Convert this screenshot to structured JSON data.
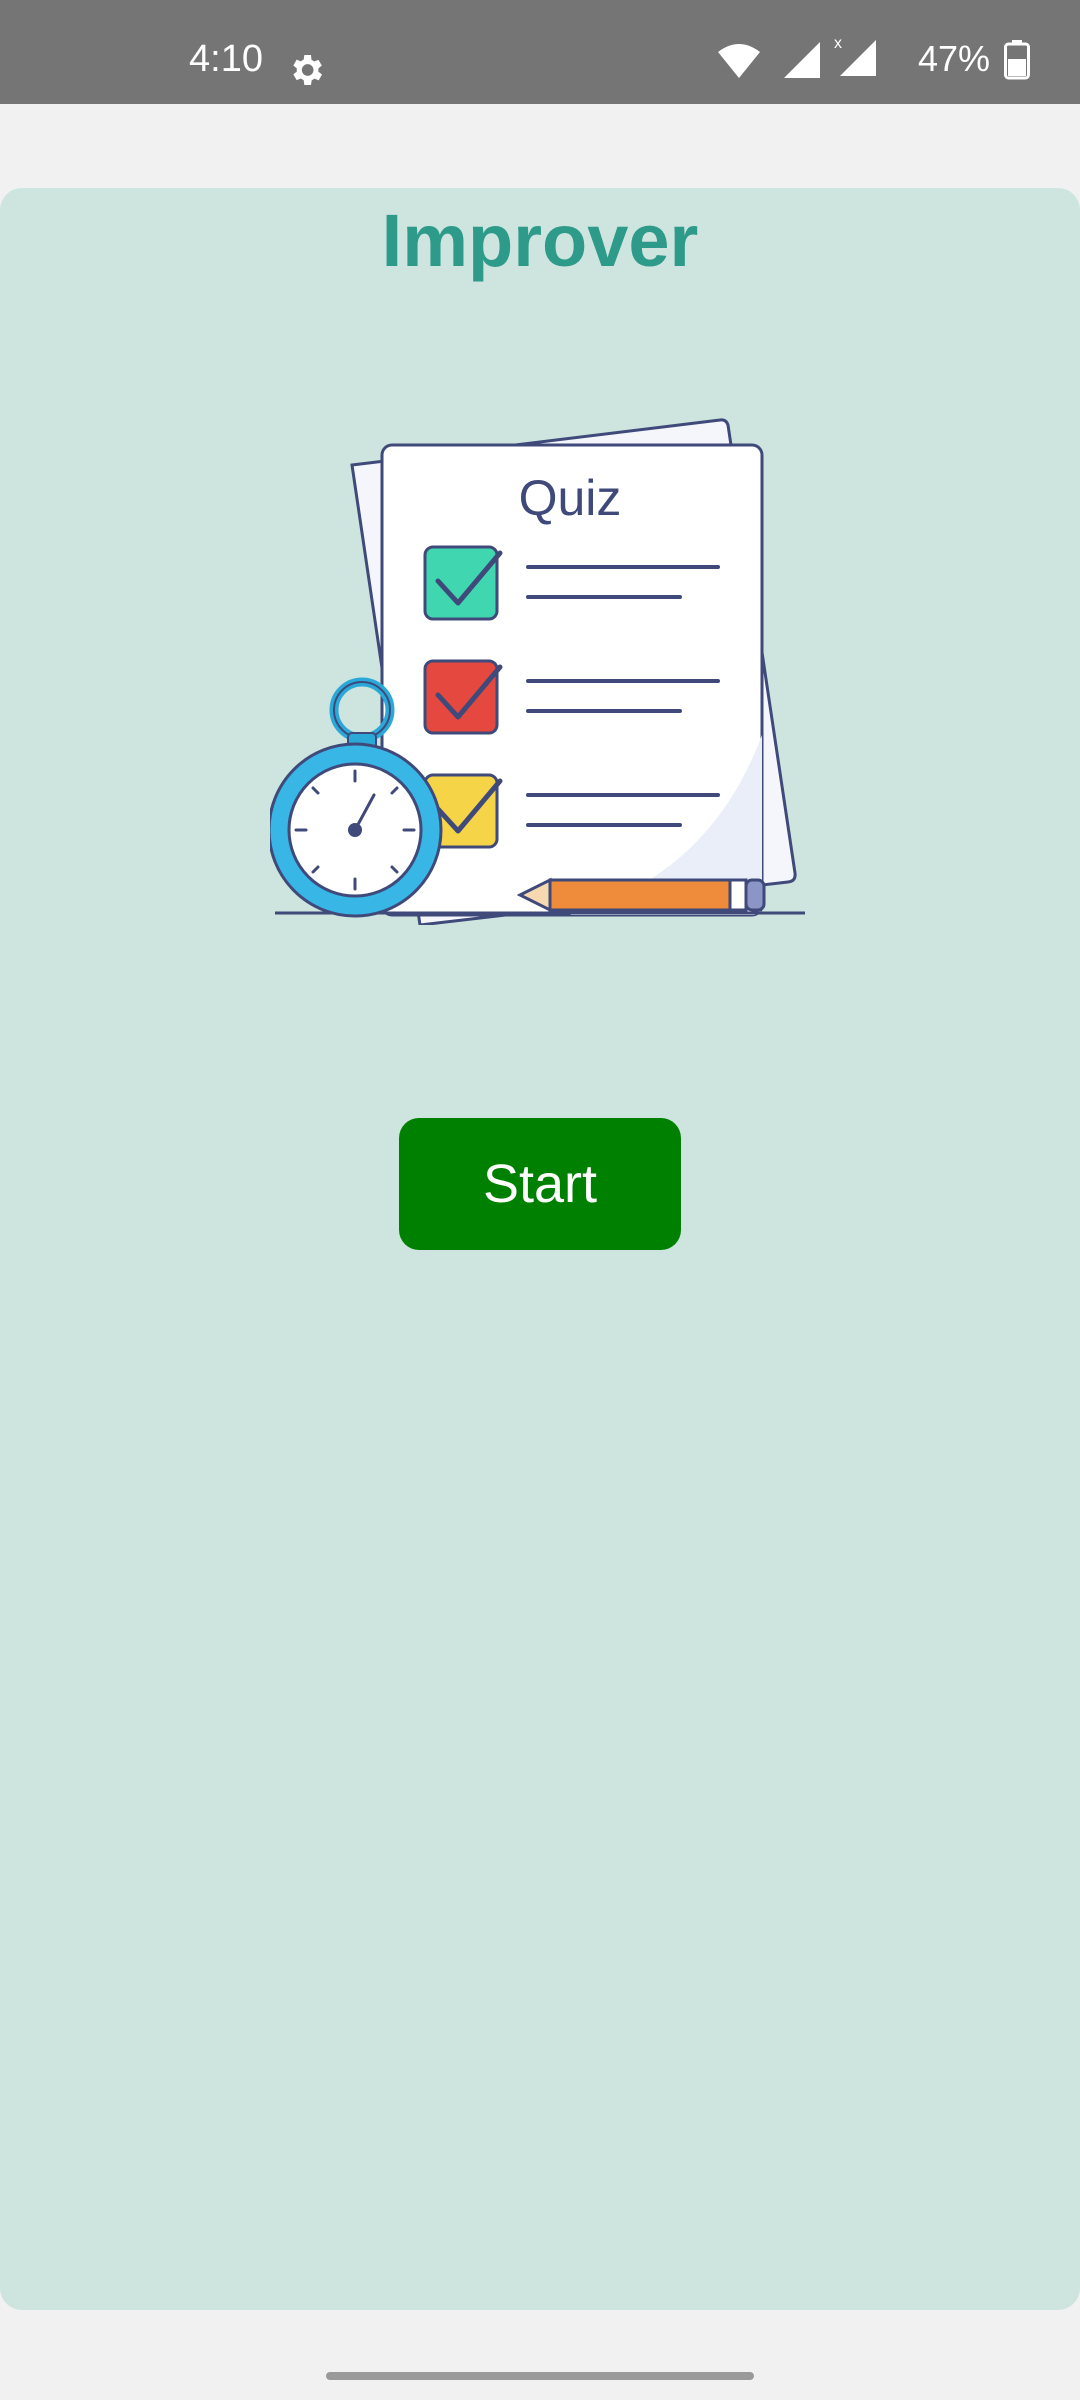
{
  "status_bar": {
    "time": "4:10",
    "battery": "47%",
    "icons": [
      "settings-gear-icon",
      "wifi-icon",
      "signal-icon",
      "signal-no-data-icon",
      "battery-icon"
    ]
  },
  "app": {
    "title": "Improver",
    "title_color": "#2e9a8a",
    "background_color": "#cde4df"
  },
  "illustration": {
    "label": "Quiz",
    "icon": "quiz-clipboard-stopwatch-illustration",
    "checkbox_colors": [
      "#3fd6b0",
      "#e5483f",
      "#f5d547"
    ]
  },
  "actions": {
    "start_label": "Start",
    "start_color": "#008000"
  }
}
